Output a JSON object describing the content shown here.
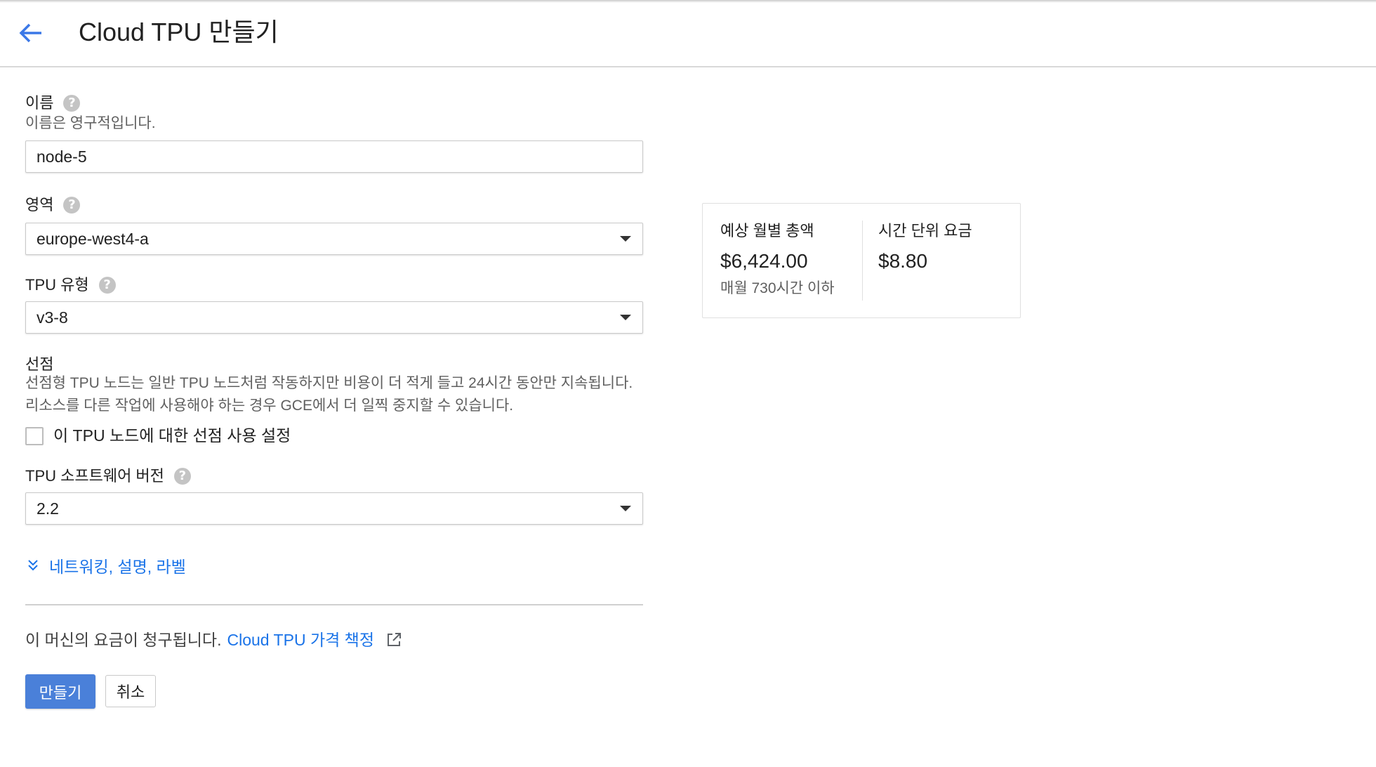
{
  "header": {
    "title": "Cloud TPU 만들기"
  },
  "form": {
    "name": {
      "label": "이름",
      "hint": "이름은 영구적입니다.",
      "value": "node-5"
    },
    "zone": {
      "label": "영역",
      "value": "europe-west4-a"
    },
    "tpu_type": {
      "label": "TPU 유형",
      "value": "v3-8"
    },
    "preemptible": {
      "label": "선점",
      "description": "선점형 TPU 노드는 일반 TPU 노드처럼 작동하지만 비용이 더 적게 들고 24시간 동안만 지속됩니다. 리소스를 다른 작업에 사용해야 하는 경우 GCE에서 더 일찍 중지할 수 있습니다.",
      "checkbox_label": "이 TPU 노드에 대한 선점 사용 설정",
      "checked": false
    },
    "software_version": {
      "label": "TPU 소프트웨어 버전",
      "value": "2.2"
    },
    "more_options": "네트워킹, 설명, 라벨",
    "billing_text": "이 머신의 요금이 청구됩니다.",
    "billing_link": "Cloud TPU 가격 책정",
    "create_button": "만들기",
    "cancel_button": "취소"
  },
  "cost": {
    "monthly_label": "예상 월별 총액",
    "monthly_value": "$6,424.00",
    "monthly_sub": "매월 730시간 이하",
    "hourly_label": "시간 단위 요금",
    "hourly_value": "$8.80"
  },
  "colors": {
    "link": "#1a73e8",
    "primary_button": "#4a80d9"
  },
  "icons": {
    "back": "arrow-left-icon",
    "help": "help-circle-icon",
    "dropdown": "caret-down-icon",
    "expand": "double-chevron-down-icon",
    "external": "external-link-icon"
  }
}
